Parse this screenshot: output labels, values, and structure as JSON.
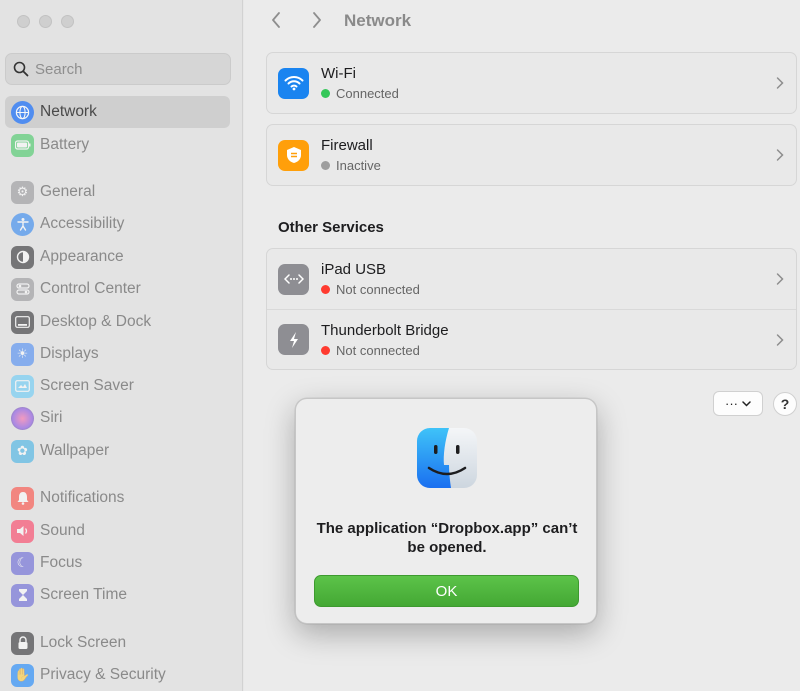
{
  "search": {
    "placeholder": "Search"
  },
  "sidebar": {
    "items": [
      {
        "label": "Network",
        "icon": "globe-icon",
        "color": "#3b82f6"
      },
      {
        "label": "Battery",
        "icon": "battery-icon",
        "color": "#34c759"
      },
      {
        "label": "General",
        "icon": "gear-icon",
        "color": "#8e8e93"
      },
      {
        "label": "Accessibility",
        "icon": "accessibility-icon",
        "color": "#1c7cf2"
      },
      {
        "label": "Appearance",
        "icon": "appearance-icon",
        "color": "#1d1d1f"
      },
      {
        "label": "Control Center",
        "icon": "control-center-icon",
        "color": "#8e8e93"
      },
      {
        "label": "Desktop & Dock",
        "icon": "dock-icon",
        "color": "#1d1d1f"
      },
      {
        "label": "Displays",
        "icon": "sun-icon",
        "color": "#3b82f6"
      },
      {
        "label": "Screen Saver",
        "icon": "screen-saver-icon",
        "color": "#5ac8fa"
      },
      {
        "label": "Siri",
        "icon": "siri-icon",
        "color": "#af52de"
      },
      {
        "label": "Wallpaper",
        "icon": "flower-icon",
        "color": "#32ade6"
      },
      {
        "label": "Notifications",
        "icon": "bell-icon",
        "color": "#ff3b30"
      },
      {
        "label": "Sound",
        "icon": "speaker-icon",
        "color": "#ff2d55"
      },
      {
        "label": "Focus",
        "icon": "moon-icon",
        "color": "#5856d6"
      },
      {
        "label": "Screen Time",
        "icon": "hourglass-icon",
        "color": "#5856d6"
      },
      {
        "label": "Lock Screen",
        "icon": "lock-icon",
        "color": "#1d1d1f"
      },
      {
        "label": "Privacy & Security",
        "icon": "hand-icon",
        "color": "#007aff"
      }
    ]
  },
  "toolbar": {
    "title": "Network"
  },
  "services": [
    {
      "title": "Wi-Fi",
      "status": "Connected",
      "status_color": "#34c759",
      "icon": "wifi-icon"
    },
    {
      "title": "Firewall",
      "status": "Inactive",
      "status_color": "#9e9e9e",
      "icon": "firewall-icon"
    }
  ],
  "other_services": {
    "title": "Other Services",
    "items": [
      {
        "title": "iPad USB",
        "status": "Not connected",
        "status_color": "#ff3b30",
        "icon": "ethernet-icon"
      },
      {
        "title": "Thunderbolt Bridge",
        "status": "Not connected",
        "status_color": "#ff3b30",
        "icon": "thunderbolt-icon"
      }
    ]
  },
  "actions": {
    "more_label": "···",
    "help_label": "?"
  },
  "dialog": {
    "message": "The application “Dropbox.app” can’t be opened.",
    "ok_label": "OK",
    "icon": "finder-icon"
  }
}
